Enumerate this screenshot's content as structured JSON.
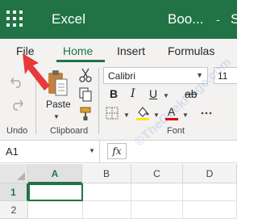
{
  "titlebar": {
    "app_name": "Excel",
    "doc_name": "Boo...",
    "separator": "-",
    "trailing": "S",
    "bg_color": "#217346"
  },
  "tabs": [
    {
      "label": "File"
    },
    {
      "label": "Home",
      "active": true
    },
    {
      "label": "Insert"
    },
    {
      "label": "Formulas"
    }
  ],
  "ribbon": {
    "undo": {
      "label": "Undo",
      "icons": [
        "undo-icon",
        "redo-icon"
      ]
    },
    "clipboard": {
      "label": "Clipboard",
      "paste_label": "Paste",
      "icons": [
        "paste-icon",
        "cut-icon",
        "copy-icon",
        "format-painter-icon"
      ]
    },
    "font": {
      "label": "Font",
      "font_name": "Calibri",
      "font_size": "11",
      "buttons": [
        "B",
        "I",
        "U",
        "ab"
      ],
      "fill_color": "#ffe600",
      "font_color": "#e00000"
    }
  },
  "formula_bar": {
    "name_box": "A1",
    "fx_label": "fx",
    "value": ""
  },
  "grid": {
    "columns": [
      "A",
      "B",
      "C",
      "D"
    ],
    "rows": [
      "1",
      "2"
    ],
    "selected_cell": "A1"
  },
  "watermark": "©TheGeekPage.com",
  "accent": "#217346",
  "annotation_arrow_color": "#e8393b"
}
